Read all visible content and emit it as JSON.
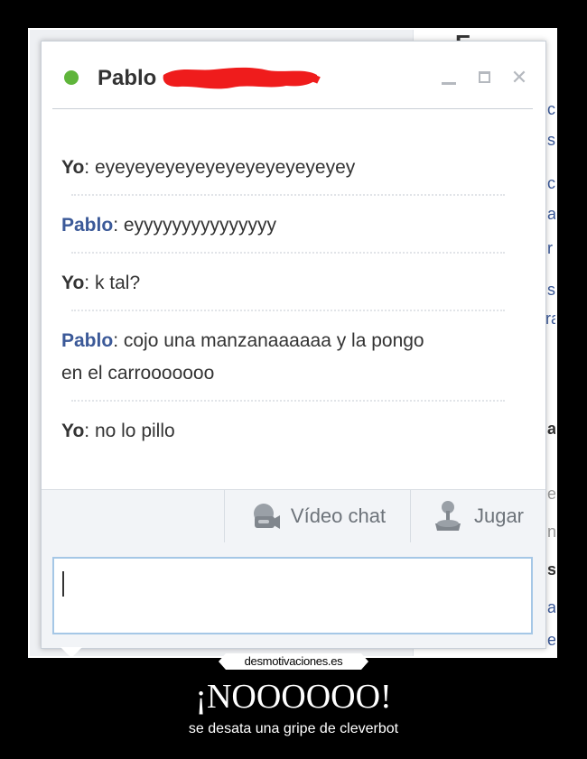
{
  "background_page": {
    "fragments": [
      "c",
      "s",
      "c",
      "a",
      "r",
      "s",
      "ra",
      "a",
      "el",
      "n",
      "s",
      "a",
      "e",
      "E"
    ]
  },
  "chat": {
    "contact_name": "Pablo",
    "status_color": "#5fb53b",
    "messages": [
      {
        "sender": "Yo",
        "text": ": eyeyeyeyeyeyeyeyeyeyeyeyey"
      },
      {
        "sender": "Pablo",
        "text": ": eyyyyyyyyyyyyyyy"
      },
      {
        "sender": "Yo",
        "text": ": k tal?"
      },
      {
        "sender": "Pablo",
        "text": ": cojo una manzanaaaaaa y la pongo",
        "line2": "en el carrooooooo"
      },
      {
        "sender": "Yo",
        "text": ": no lo pillo"
      }
    ],
    "toolbar": {
      "video_chat_label": "Vídeo chat",
      "play_label": "Jugar"
    },
    "input": {
      "value": "",
      "placeholder": ""
    }
  },
  "poster": {
    "watermark": "desmotivaciones.es",
    "title": "¡NOOOOOO!",
    "subtitle": "se desata una gripe de cleverbot"
  },
  "colors": {
    "self_sender": "#333333",
    "other_sender": "#3b5998",
    "poster_background": "#000000"
  }
}
